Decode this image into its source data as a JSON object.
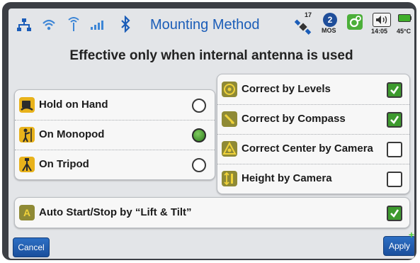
{
  "header": {
    "title": "Mounting Method",
    "satellite_count": "17",
    "mos_number": "2",
    "mos_label": "MOS",
    "time": "14:05",
    "temperature": "45°C",
    "status_icons": [
      "network-icon",
      "wifi-icon",
      "antenna-icon",
      "signal-bars-icon",
      "bluetooth-icon",
      "satellite-icon",
      "mos-icon",
      "gear-icon",
      "speaker-icon",
      "battery-icon"
    ]
  },
  "heading": "Effective only when internal antenna is used",
  "mounting_options": [
    {
      "label": "Hold on Hand",
      "selected": false,
      "icon": "hand-hold-icon"
    },
    {
      "label": "On Monopod",
      "selected": true,
      "icon": "monopod-icon"
    },
    {
      "label": "On Tripod",
      "selected": false,
      "icon": "tripod-icon"
    }
  ],
  "corrections": [
    {
      "label": "Correct by Levels",
      "checked": true,
      "icon": "level-icon"
    },
    {
      "label": "Correct by Compass",
      "checked": true,
      "icon": "compass-icon"
    },
    {
      "label": "Correct Center by Camera",
      "checked": false,
      "icon": "camera-center-icon"
    },
    {
      "label": "Height by Camera",
      "checked": false,
      "icon": "camera-height-icon"
    }
  ],
  "auto_start": {
    "icon_letter": "A",
    "label": "Auto Start/Stop by “Lift & Tilt”",
    "checked": true
  },
  "footer": {
    "cancel_label": "Cancel",
    "apply_label": "Apply"
  },
  "colors": {
    "title": "#1b5db8",
    "button": "#1a4f9c",
    "check_on": "#3d9a2e",
    "radio_on": "#2e7d1e",
    "icon_yellow": "#e8b21b",
    "icon_olive": "#8f8a35"
  }
}
